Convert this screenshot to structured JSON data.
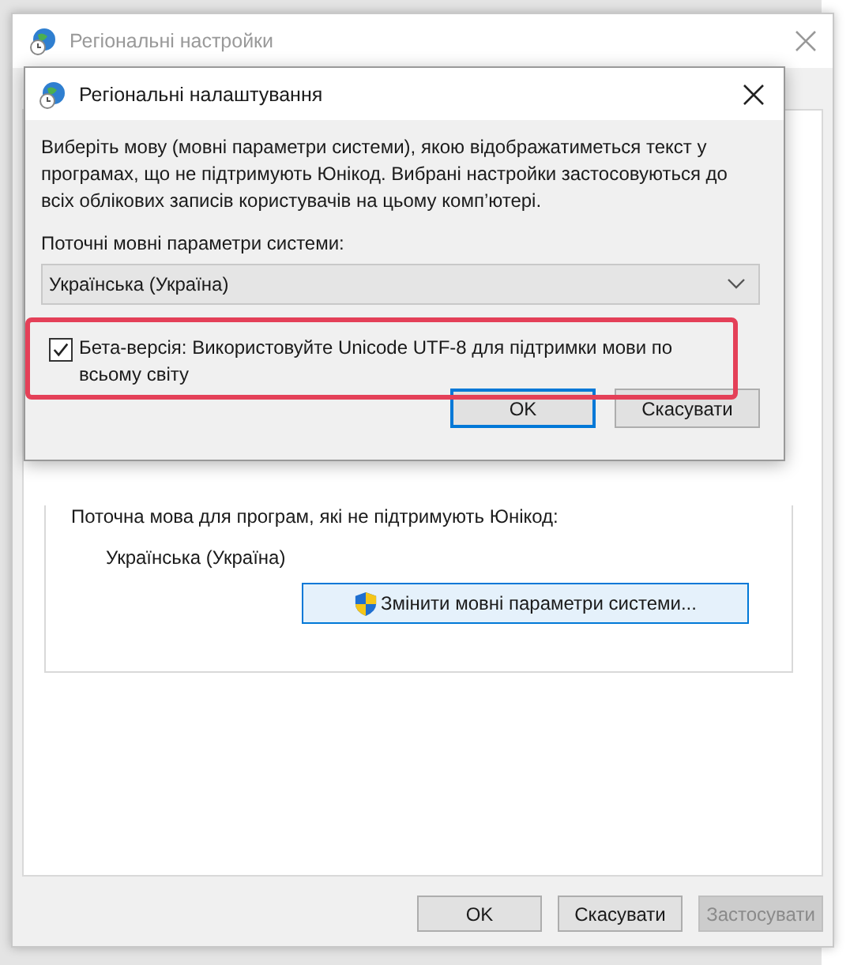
{
  "main_window": {
    "title": "Регіональні настройки",
    "current_language_label": "Поточна мова для програм, які не підтримують Юнікод:",
    "current_language": "Українська (Україна)",
    "change_button": "Змінити мовні параметри системи...",
    "buttons": [
      {
        "label": "OK",
        "disabled": false
      },
      {
        "label": "Скасувати",
        "disabled": false
      },
      {
        "label": "Застосувати",
        "disabled": true
      }
    ]
  },
  "dialog": {
    "title": "Регіональні налаштування",
    "description": "Виберіть мову (мовні параметри системи), якою відображатиметься текст у програмах, що не підтримують Юнікод. Вибрані настройки застосовуються до всіх облікових записів користувачів на цьому комп’ютері.",
    "locale_label": "Поточні мовні параметри системи:",
    "locale_value": "Українська (Україна)",
    "beta_checkbox": {
      "label": "Бета-версія: Використовуйте Unicode UTF-8 для підтримки мови по всьому світу",
      "checked": true,
      "highlighted": true
    },
    "buttons": [
      {
        "label": "OK",
        "default": true
      },
      {
        "label": "Скасувати",
        "default": false
      }
    ]
  }
}
